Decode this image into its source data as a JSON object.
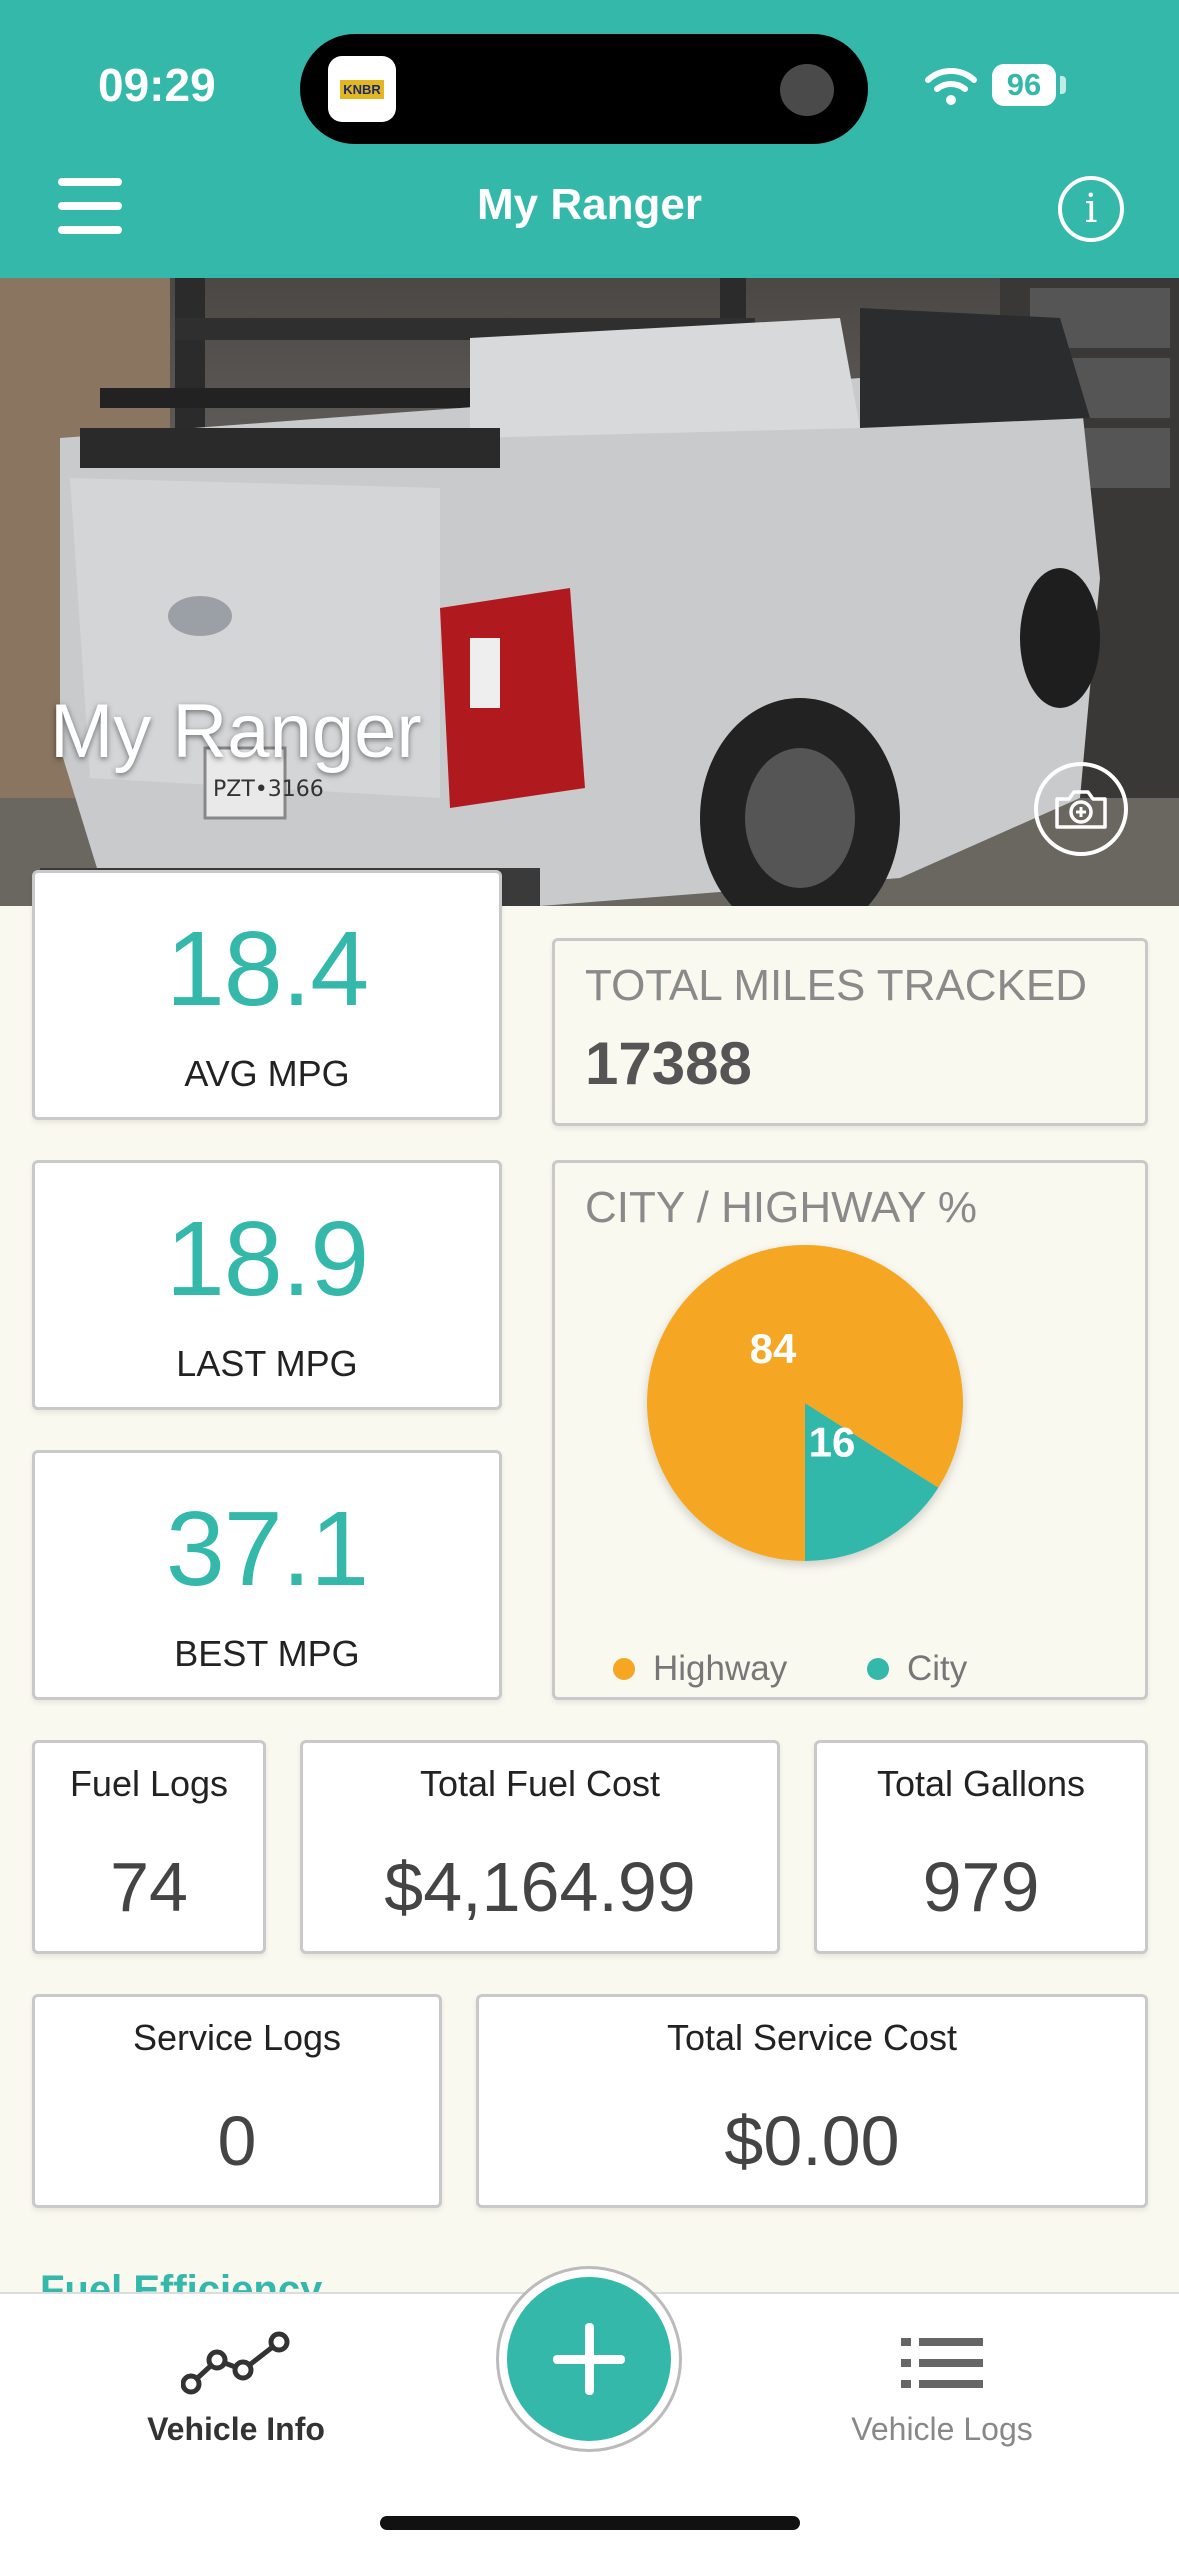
{
  "status": {
    "time": "09:29",
    "battery": "96",
    "island_app_text": "KNBR"
  },
  "header": {
    "title": "My Ranger"
  },
  "hero": {
    "vehicle_name": "My Ranger",
    "plate_text": "PZT•3166"
  },
  "stats": {
    "avg_mpg": {
      "value": "18.4",
      "label": "AVG MPG"
    },
    "last_mpg": {
      "value": "18.9",
      "label": "LAST MPG"
    },
    "best_mpg": {
      "value": "37.1",
      "label": "BEST MPG"
    },
    "total_miles": {
      "title": "TOTAL MILES TRACKED",
      "value": "17388"
    },
    "fuel_logs": {
      "title": "Fuel Logs",
      "value": "74"
    },
    "total_fuel_cost": {
      "title": "Total Fuel Cost",
      "value": "$4,164.99"
    },
    "total_gallons": {
      "title": "Total Gallons",
      "value": "979"
    },
    "service_logs": {
      "title": "Service Logs",
      "value": "0"
    },
    "total_service_cost": {
      "title": "Total Service Cost",
      "value": "$0.00"
    }
  },
  "city_highway": {
    "title": "CITY / HIGHWAY %",
    "highway_label": "84",
    "city_label": "16",
    "legend_highway": "Highway",
    "legend_city": "City"
  },
  "chart_data": {
    "type": "pie",
    "title": "CITY / HIGHWAY %",
    "categories": [
      "Highway",
      "City"
    ],
    "values": [
      84,
      16
    ],
    "colors": [
      "#f5a623",
      "#33b8aa"
    ],
    "legend": "bottom"
  },
  "section_peek": "Fuel Efficiency",
  "tabs": {
    "vehicle_info": "Vehicle Info",
    "vehicle_logs": "Vehicle Logs"
  },
  "colors": {
    "accent": "#33b8aa",
    "highway": "#f5a623"
  }
}
